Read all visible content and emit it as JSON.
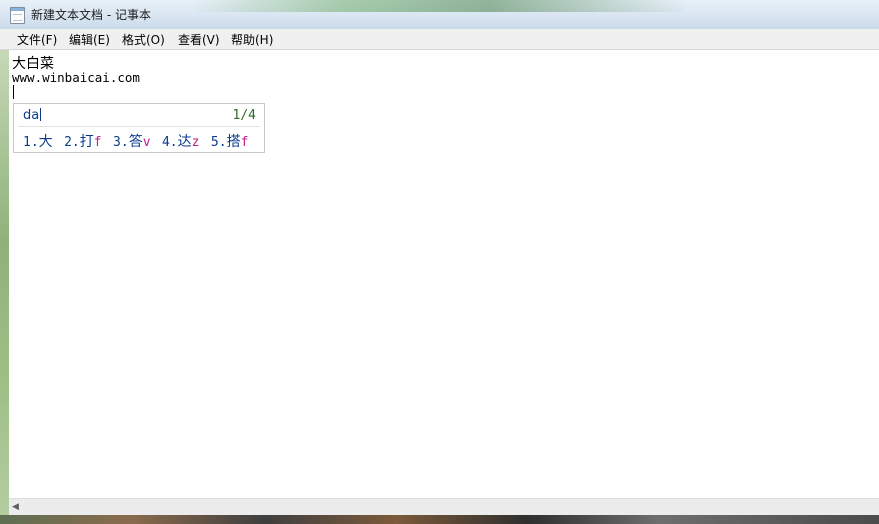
{
  "window": {
    "title": "新建文本文档 - 记事本",
    "icon": "notepad-icon"
  },
  "menu": {
    "items": [
      {
        "label": "文件(F)"
      },
      {
        "label": "编辑(E)"
      },
      {
        "label": "格式(O)"
      },
      {
        "label": "查看(V)"
      },
      {
        "label": "帮助(H)"
      }
    ]
  },
  "document": {
    "lines": [
      "大白菜",
      "www.winbaicai.com"
    ]
  },
  "ime": {
    "input": "da",
    "page": "1/4",
    "candidates": [
      {
        "num": "1.",
        "char": "大",
        "hint": ""
      },
      {
        "num": "2.",
        "char": "打",
        "hint": "f"
      },
      {
        "num": "3.",
        "char": "答",
        "hint": "v"
      },
      {
        "num": "4.",
        "char": "达",
        "hint": "z"
      },
      {
        "num": "5.",
        "char": "搭",
        "hint": "f"
      }
    ]
  },
  "scrollbar": {
    "left_arrow_icon": "scroll-left-arrow-icon"
  },
  "colors": {
    "candidate_text": "#0b3c8c",
    "candidate_hint": "#c41a8a",
    "page_indicator": "#2c6a2c"
  }
}
